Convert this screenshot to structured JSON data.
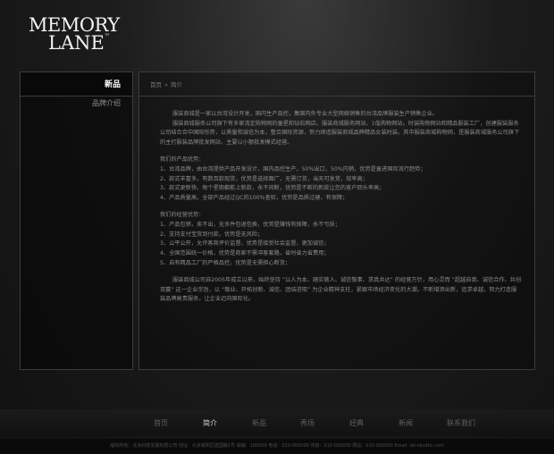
{
  "logo": {
    "line1": "MEMORY",
    "line2": "LANE",
    "tm": "™"
  },
  "sidebar": {
    "heading": "新品",
    "items": [
      {
        "label": "品牌介绍"
      }
    ]
  },
  "breadcrumb": {
    "home": "首页",
    "separator": "»",
    "current": "简介"
  },
  "content": {
    "intro": [
      "服装商城是一家以台湾设计开发，国内生产品控，集国内外专业大型网络销售的台湾品牌服装生产销售企业。",
      "服装商城服务公司旗下有多家湾定购物网的童星和钻石网店。服装商城服务网站、1偕购物网站。时装购物网站和精品服装工厂，创建服装服务公司结合合中国际形势，以质量和诚信为本，整合国际资源，努力缔造服装商城品牌精品女装时装。其中服装商城购物网，是服装商城服务公司旗下的主打服装品牌批发网站，主要以小额批发模式经营。"
    ],
    "product_heading": "我们的产品优势：",
    "product_items": [
      "1、台湾品牌，由台湾提供产品开发设计，国内品控生产，50%出口，50%内销，优势是童进国际流行趋势；",
      "2、款式丰富多，有数百款现货，优势是选择面广，无需订货，当天可发货，效率高；",
      "3、款式更新快，每个星期都能上新款，永不间断，优势是不断的新款让您的客户回头率高；",
      "4、产品质量高，全部产品经过QC的100%查验，优势是品质过硬，有保障；"
    ],
    "business_heading": "我们的经营优势：",
    "business_items": [
      "1、产品包销，卖不出，无多件包退包换，优势是赚钱有保障，永不亏损；",
      "2、支持支付宝货到付款，优势是无风险；",
      "3、公平公开，允许客商评价监督，优势是接受社会监督，更加诚信；",
      "4、全国范围统一价格，优势是商家不需冲客套路，省时省力省费用；",
      "5、自有精品工厂的严格品控，优势是无需担心断货；"
    ],
    "closing": "服装商城公司自2005年成立以来，始终坚持 “以人为本、踏实做人、诚信敬事、求真共达” 的经营方针，用心灵而 “超越自我、诚信合作、共创双赢” 这一企业宗旨，以 “敬业、开拓创新、诚信、团结进取” 为企业精神支柱，紧跟市场经济变化的大潮，不断增添出新，追求卓越，努力打造服装品牌高贵服务，让企业迈向国际化。"
  },
  "footer_nav": {
    "items": [
      {
        "label": "首页",
        "active": false
      },
      {
        "label": "简介",
        "active": true
      },
      {
        "label": "新品",
        "active": false
      },
      {
        "label": "秀场",
        "active": false
      },
      {
        "label": "经典",
        "active": false
      },
      {
        "label": "新闻",
        "active": false
      },
      {
        "label": "联系我们",
        "active": false
      }
    ]
  },
  "copyright": "版权所有：北京科技发展有限公司  地址：北京朝阳区建国路1号  邮编：100000   电话：010-000000   传真：010-000000   网站：010-000000  Email: ab-cbcdbc.com"
}
